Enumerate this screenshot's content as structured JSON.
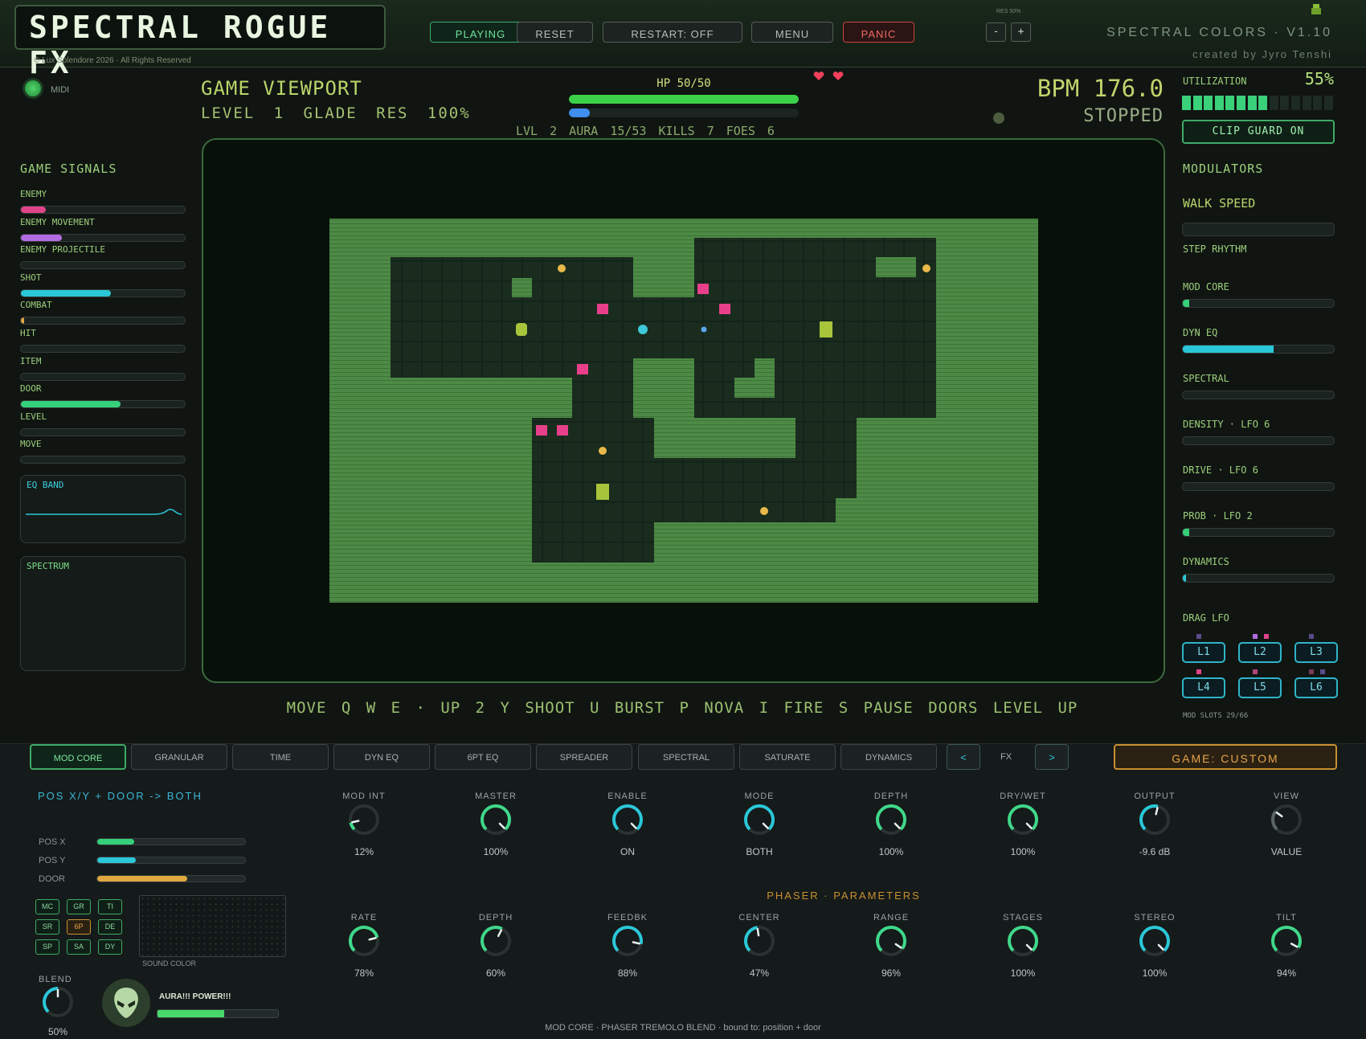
{
  "header": {
    "logo": "SPECTRAL ROGUE FX",
    "copyright": "© Lux Splendore 2026 · All Rights Reserved",
    "buttons": {
      "playing": "PLAYING",
      "reset": "RESET",
      "restart": "RESTART: OFF",
      "menu": "MENU",
      "panic": "PANIC"
    },
    "res_label": "RES 50%",
    "res_minus": "-",
    "res_plus": "+",
    "version": "SPECTRAL COLORS · V1.10",
    "credit": "created by Jyro Tenshi"
  },
  "left": {
    "midi_label": "MIDI",
    "signals_title": "GAME SIGNALS",
    "signals": [
      {
        "label": "ENEMY",
        "level": 0.15,
        "color": "#e0458a"
      },
      {
        "label": "ENEMY MOVEMENT",
        "level": 0.25,
        "color": "#b26be0"
      },
      {
        "label": "ENEMY PROJECTILE",
        "level": 0.0,
        "color": "#2ac7d8"
      },
      {
        "label": "SHOT",
        "level": 0.55,
        "color": "#2ac7d8"
      },
      {
        "label": "COMBAT",
        "level": 0.02,
        "color": "#e0a840"
      },
      {
        "label": "HIT",
        "level": 0.0,
        "color": "#2ac7d8"
      },
      {
        "label": "ITEM",
        "level": 0.0,
        "color": "#2ac7d8"
      },
      {
        "label": "DOOR",
        "level": 0.61,
        "color": "#35d07a"
      },
      {
        "label": "LEVEL",
        "level": 0.0,
        "color": "#2ac7d8"
      },
      {
        "label": "MOVE",
        "level": 0.0,
        "color": "#2ac7d8"
      }
    ],
    "eq_band_title": "EQ BAND",
    "spectrum_title": "SPECTRUM"
  },
  "viewport": {
    "title": "GAME VIEWPORT",
    "subtitle": "LEVEL 1   GLADE   RES 100%",
    "hp_label": "HP 50/50",
    "hp_level": 1.0,
    "aura_level": 0.09,
    "stats": "LVL 2    AURA 15/53    KILLS 7    FOES 6",
    "bpm": "BPM 176.0",
    "transport": "STOPPED",
    "controls": "MOVE Q W E · UP 2   Y SHOOT  U BURST  P NOVA  I FIRE  S PAUSE   DOORS LEVEL UP"
  },
  "right": {
    "util_label": "UTILIZATION",
    "util_value": "55%",
    "util_segments_on": 8,
    "util_segments_total": 14,
    "clip_guard": "CLIP GUARD ON",
    "modulators_title": "MODULATORS",
    "walk_speed": "WALK SPEED",
    "walk_level": 0.0,
    "step_rhythm": "STEP RHYTHM",
    "mods": [
      {
        "label": "MOD CORE",
        "level": 0.04,
        "color": "#35d07a"
      },
      {
        "label": "DYN EQ",
        "level": 0.6,
        "color": "#2ac7d8"
      },
      {
        "label": "SPECTRAL",
        "level": 0.0,
        "color": "#2ac7d8"
      },
      {
        "label": "DENSITY · LFO 6",
        "level": 0.0,
        "color": "#2ac7d8"
      },
      {
        "label": "DRIVE · LFO 6",
        "level": 0.0,
        "color": "#2ac7d8"
      },
      {
        "label": "PROB · LFO 2",
        "level": 0.04,
        "color": "#35d07a"
      },
      {
        "label": "DYNAMICS",
        "level": 0.02,
        "color": "#2ac7d8"
      }
    ],
    "drag_lfo": "DRAG LFO",
    "lfos": [
      "L1",
      "L2",
      "L3",
      "L4",
      "L5",
      "L6"
    ],
    "mod_slots": "MOD SLOTS 29/66"
  },
  "tabs": {
    "items": [
      "MOD CORE",
      "GRANULAR",
      "TIME",
      "DYN EQ",
      "6PT EQ",
      "SPREADER",
      "SPECTRAL",
      "SATURATE",
      "DYNAMICS"
    ],
    "prev": "<",
    "fx": "FX",
    "next": ">",
    "game_preset": "GAME: CUSTOM"
  },
  "modcore": {
    "routing": "POS X/Y + DOOR -> BOTH",
    "pos": [
      {
        "label": "POS X",
        "level": 0.25,
        "color": "#35d07a"
      },
      {
        "label": "POS Y",
        "level": 0.26,
        "color": "#2ac7d8"
      },
      {
        "label": "DOOR",
        "level": 0.61,
        "color": "#e0a840"
      }
    ],
    "nodes": [
      "MC",
      "GR",
      "TI",
      "SR",
      "6P",
      "DE",
      "SP",
      "SA",
      "DY"
    ],
    "sound_color": "SOUND COLOR",
    "blend_label": "BLEND",
    "blend_value": "50%",
    "blend_level": 0.5,
    "aura_text": "AURA!!! POWER!!!",
    "aura_level": 0.55,
    "knobs_top": [
      {
        "label": "MOD INT",
        "value": "12%",
        "level": 0.12
      },
      {
        "label": "MASTER",
        "value": "100%",
        "level": 1.0
      },
      {
        "label": "ENABLE",
        "value": "ON",
        "level": 1.0
      },
      {
        "label": "MODE",
        "value": "BOTH",
        "level": 1.0
      },
      {
        "label": "DEPTH",
        "value": "100%",
        "level": 1.0
      },
      {
        "label": "DRY/WET",
        "value": "100%",
        "level": 1.0
      },
      {
        "label": "OUTPUT",
        "value": "-9.6 dB",
        "level": 0.55
      },
      {
        "label": "VIEW",
        "value": "VALUE",
        "level": 0.3
      }
    ],
    "phaser_title": "PHASER  ·  PARAMETERS",
    "knobs_bottom": [
      {
        "label": "RATE",
        "value": "78%",
        "level": 0.78
      },
      {
        "label": "DEPTH",
        "value": "60%",
        "level": 0.6
      },
      {
        "label": "FEEDBK",
        "value": "88%",
        "level": 0.88
      },
      {
        "label": "CENTER",
        "value": "47%",
        "level": 0.47
      },
      {
        "label": "RANGE",
        "value": "96%",
        "level": 0.96
      },
      {
        "label": "STAGES",
        "value": "100%",
        "level": 1.0
      },
      {
        "label": "STEREO",
        "value": "100%",
        "level": 1.0
      },
      {
        "label": "TILT",
        "value": "94%",
        "level": 0.94
      }
    ],
    "footer": "MOD CORE  ·  PHASER  TREMOLO  BLEND  ·  bound to: position + door"
  }
}
